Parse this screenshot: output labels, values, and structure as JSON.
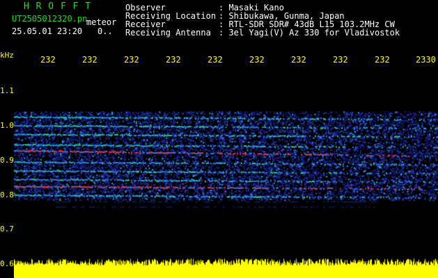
{
  "header": {
    "logo": "H R O F F T",
    "filename": "UT2505012320.pn",
    "mode": "meteor",
    "datetime": "25.05.01 23:20",
    "count": "0..",
    "info_labels": [
      "Observer",
      "Receiving Location",
      "Receiver",
      "Receiving Antenna"
    ],
    "info_values": [
      ": Masaki Kano",
      ": Shibukawa, Gunma, Japan",
      ": RTL-SDR SDR# 43dB L15 103.2MHz CW",
      ": 3el Yagi(V) Az 330 for Vladivostok"
    ]
  },
  "axis": {
    "unit": "kHz",
    "y_ticks": [
      "1.1",
      "1.0",
      "0.9",
      "0.8",
      "0.7",
      "0.6"
    ],
    "x_ticks": [
      "232",
      "232",
      "232",
      "232",
      "232",
      "232",
      "232",
      "232",
      "232",
      "2330"
    ]
  },
  "colors": {
    "background": "#000000",
    "noise": "#1a2a9a",
    "trace_strong": "#ff3040",
    "trace_mid": "#30d0a0",
    "level_bar": "#ffff00"
  },
  "chart_data": {
    "type": "heatmap",
    "ylabel": "kHz",
    "ylim": [
      0.6,
      1.15
    ],
    "traces_khz": [
      1.025,
      1.0,
      0.975,
      0.945,
      0.928,
      0.895,
      0.87,
      0.845,
      0.825,
      0.8
    ]
  }
}
